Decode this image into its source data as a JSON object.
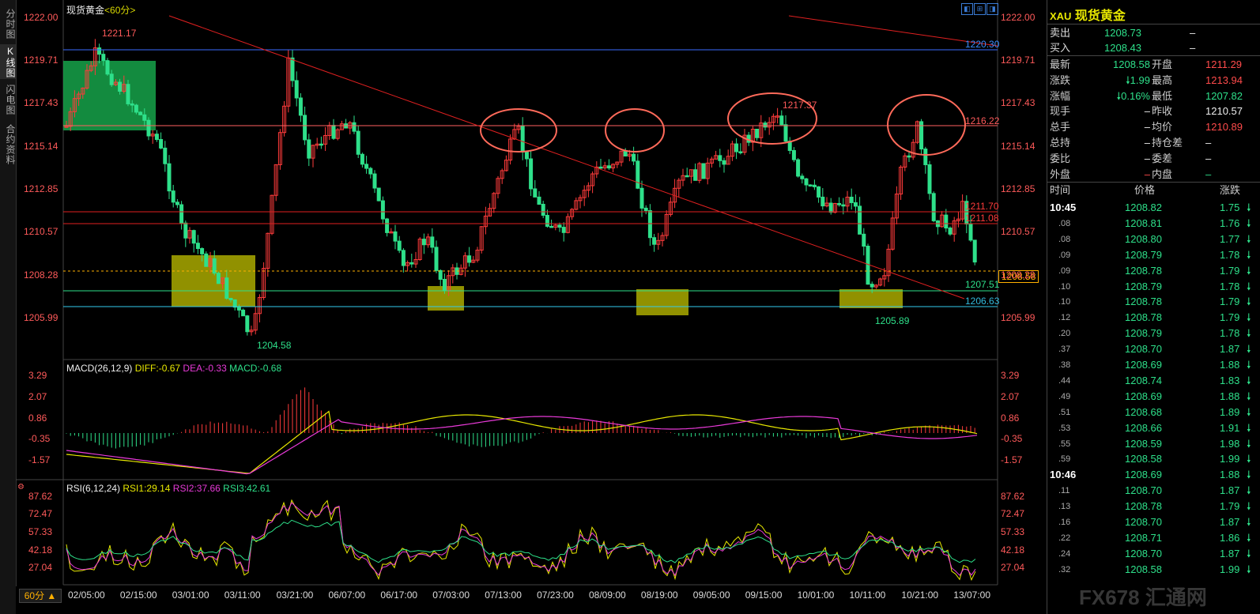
{
  "left_tabs": [
    {
      "label": "分时图",
      "active": false
    },
    {
      "label": "K线图",
      "active": true
    },
    {
      "label": "闪电图",
      "active": false
    },
    {
      "label": "合约资料",
      "active": false
    }
  ],
  "chart": {
    "title": "现货黄金",
    "period": "<60分>",
    "price_ticks": [
      "1222.00",
      "1219.71",
      "1217.43",
      "1215.14",
      "1212.85",
      "1210.57",
      "1208.28",
      "1205.99"
    ],
    "annotations": {
      "high": "1221.17",
      "low": "1204.58",
      "peak2": "1217.37",
      "low2": "1205.89",
      "level_1220": "1220.30",
      "level_1216": "1216.22",
      "level_1211a": "1211.70",
      "level_1211b": "1211.08",
      "level_1207": "1207.51",
      "level_1206": "1206.63",
      "current_price": "1208.58"
    },
    "colors": {
      "up": "#ff3b3b",
      "down": "#2ee08a",
      "bg": "#000000"
    }
  },
  "macd": {
    "title": "MACD(26,12,9)",
    "diff": "DIFF:-0.67",
    "dea": "DEA:-0.33",
    "macd": "MACD:-0.68",
    "ticks": [
      "3.29",
      "2.07",
      "0.86",
      "-0.35",
      "-1.57"
    ]
  },
  "rsi": {
    "title": "RSI(6,12,24)",
    "rsi1": "RSI1:29.14",
    "rsi2": "RSI2:37.66",
    "rsi3": "RSI3:42.61",
    "ticks": [
      "87.62",
      "72.47",
      "57.33",
      "42.18",
      "27.04"
    ]
  },
  "time_axis": [
    "02/05:00",
    "02/15:00",
    "03/01:00",
    "03/11:00",
    "03/21:00",
    "06/07:00",
    "06/17:00",
    "07/03:00",
    "07/13:00",
    "07/23:00",
    "08/09:00",
    "08/19:00",
    "09/05:00",
    "09/15:00",
    "10/01:00",
    "10/11:00",
    "10/21:00",
    "13/07:00"
  ],
  "period_button": "60分 ▲",
  "quote": {
    "symbol": "XAU",
    "name": "现货黄金",
    "sell_label": "卖出",
    "sell": "1208.73",
    "sell_extra": "–",
    "buy_label": "买入",
    "buy": "1208.43",
    "buy_extra": "–",
    "stats": [
      {
        "l1": "最新",
        "v1": "1208.58",
        "c1": "g",
        "l2": "开盘",
        "v2": "1211.29",
        "c2": "r"
      },
      {
        "l1": "涨跌",
        "v1": "🠗1.99",
        "c1": "g",
        "l2": "最高",
        "v2": "1213.94",
        "c2": "r"
      },
      {
        "l1": "涨幅",
        "v1": "🠗0.16%",
        "c1": "g",
        "l2": "最低",
        "v2": "1207.82",
        "c2": "g"
      },
      {
        "l1": "现手",
        "v1": "–",
        "c1": "w",
        "l2": "昨收",
        "v2": "1210.57",
        "c2": "w"
      },
      {
        "l1": "总手",
        "v1": "–",
        "c1": "w",
        "l2": "均价",
        "v2": "1210.89",
        "c2": "r"
      },
      {
        "l1": "总持",
        "v1": "–",
        "c1": "w",
        "l2": "持仓差",
        "v2": "–",
        "c2": "w"
      },
      {
        "l1": "委比",
        "v1": "–",
        "c1": "w",
        "l2": "委差",
        "v2": "–",
        "c2": "w"
      },
      {
        "l1": "外盘",
        "v1": "–",
        "c1": "r",
        "l2": "内盘",
        "v2": "–",
        "c2": "g"
      }
    ],
    "ticks_header": {
      "time": "时间",
      "price": "价格",
      "change": "涨跌"
    },
    "ticks": [
      {
        "t": "10:45",
        "p": "1208.82",
        "c": "1.75"
      },
      {
        "t": ".08",
        "p": "1208.81",
        "c": "1.76"
      },
      {
        "t": ".08",
        "p": "1208.80",
        "c": "1.77"
      },
      {
        "t": ".09",
        "p": "1208.79",
        "c": "1.78"
      },
      {
        "t": ".09",
        "p": "1208.78",
        "c": "1.79"
      },
      {
        "t": ".10",
        "p": "1208.79",
        "c": "1.78"
      },
      {
        "t": ".10",
        "p": "1208.78",
        "c": "1.79"
      },
      {
        "t": ".12",
        "p": "1208.78",
        "c": "1.79"
      },
      {
        "t": ".20",
        "p": "1208.79",
        "c": "1.78"
      },
      {
        "t": ".37",
        "p": "1208.70",
        "c": "1.87"
      },
      {
        "t": ".38",
        "p": "1208.69",
        "c": "1.88"
      },
      {
        "t": ".44",
        "p": "1208.74",
        "c": "1.83"
      },
      {
        "t": ".49",
        "p": "1208.69",
        "c": "1.88"
      },
      {
        "t": ".51",
        "p": "1208.68",
        "c": "1.89"
      },
      {
        "t": ".53",
        "p": "1208.66",
        "c": "1.91"
      },
      {
        "t": ".55",
        "p": "1208.59",
        "c": "1.98"
      },
      {
        "t": ".59",
        "p": "1208.58",
        "c": "1.99"
      },
      {
        "t": "10:46",
        "p": "1208.69",
        "c": "1.88"
      },
      {
        "t": ".11",
        "p": "1208.70",
        "c": "1.87"
      },
      {
        "t": ".13",
        "p": "1208.78",
        "c": "1.79"
      },
      {
        "t": ".16",
        "p": "1208.70",
        "c": "1.87"
      },
      {
        "t": ".22",
        "p": "1208.71",
        "c": "1.86"
      },
      {
        "t": ".24",
        "p": "1208.70",
        "c": "1.87"
      },
      {
        "t": ".32",
        "p": "1208.58",
        "c": "1.99"
      }
    ]
  },
  "watermark": "FX678 汇通网"
}
